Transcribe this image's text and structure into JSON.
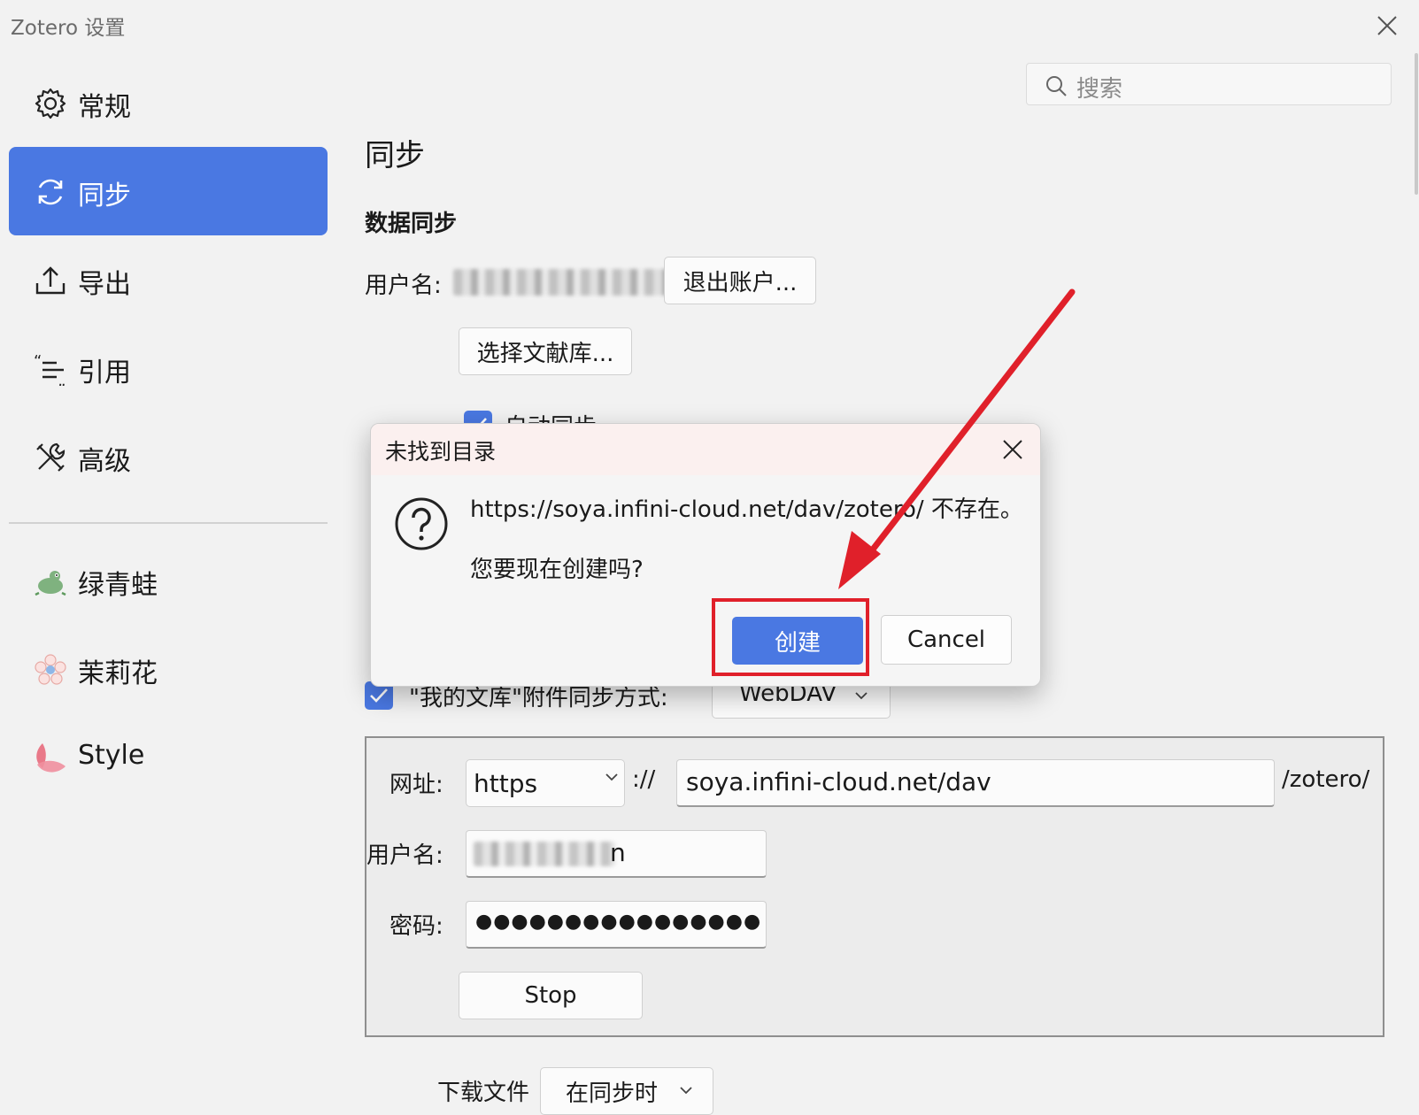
{
  "window": {
    "title": "Zotero 设置"
  },
  "search": {
    "placeholder": "搜索"
  },
  "nav": {
    "items": [
      {
        "label": "常规",
        "icon": "gear-icon"
      },
      {
        "label": "同步",
        "icon": "sync-icon",
        "active": true
      },
      {
        "label": "导出",
        "icon": "export-icon"
      },
      {
        "label": "引用",
        "icon": "cite-icon"
      },
      {
        "label": "高级",
        "icon": "tools-icon"
      }
    ],
    "plugins": [
      {
        "label": "绿青蛙",
        "icon": "frog-icon"
      },
      {
        "label": "茉莉花",
        "icon": "jasmine-icon"
      },
      {
        "label": "Style",
        "icon": "style-icon"
      }
    ]
  },
  "sync": {
    "title": "同步",
    "data_sync_heading": "数据同步",
    "username_label": "用户名:",
    "logout_button": "退出账户...",
    "choose_libraries_button": "选择文献库...",
    "auto_sync_label": "自动同步",
    "file_sync_checkbox_label": "\"我的文库\"附件同步方式:",
    "file_sync_method": "WebDAV",
    "url_label": "网址:",
    "protocol": "https",
    "protocol_sep": "://",
    "server": "soya.infini-cloud.net/dav",
    "path_suffix": "/zotero/",
    "webdav_username_label": "用户名:",
    "webdav_username_visible": "n",
    "password_label": "密码:",
    "password_mask": "●●●●●●●●●●●●●●●●",
    "stop_button": "Stop",
    "download_label": "下载文件",
    "download_option": "在同步时"
  },
  "dialog": {
    "title": "未找到目录",
    "message": "https://soya.infini-cloud.net/dav/zotero/ 不存在。",
    "question": "您要现在创建吗?",
    "primary_button": "创建",
    "cancel_button": "Cancel"
  },
  "colors": {
    "accent": "#4a78e2",
    "annotation": "#e0202a"
  }
}
